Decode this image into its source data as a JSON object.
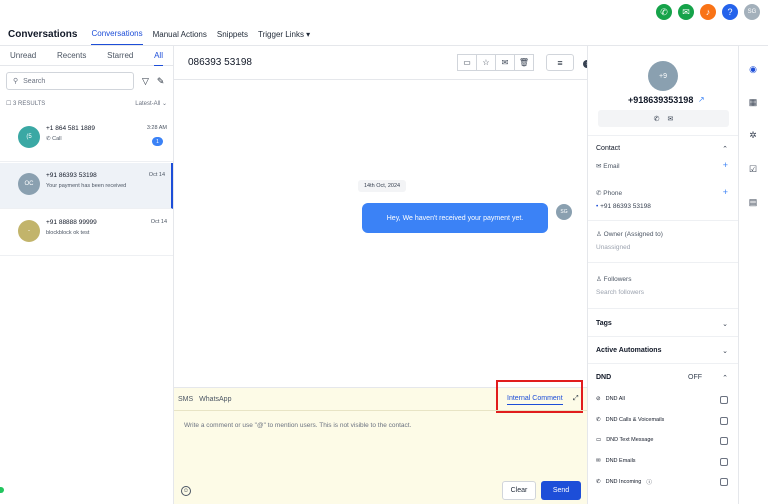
{
  "topbar": {
    "avatar_initials": "SG",
    "help_glyph": "?"
  },
  "nav": {
    "brand": "Conversations",
    "items": [
      "Conversations",
      "Manual Actions",
      "Snippets",
      "Trigger Links ▾"
    ]
  },
  "tabs": [
    "Unread",
    "Recents",
    "Starred",
    "All"
  ],
  "search": {
    "placeholder": "Search"
  },
  "results": {
    "count": "3 RESULTS",
    "filter": "Latest-All"
  },
  "conversations": [
    {
      "initials": "(5",
      "name": "+1 864 581 1889",
      "sub": "Call",
      "time": "3:28 AM",
      "badge": "1",
      "color": "#3aa8a4"
    },
    {
      "initials": "OC",
      "name": "+91 86393 53198",
      "sub": "Your payment has been received",
      "time": "Oct 14",
      "color": "#8aa0b0"
    },
    {
      "initials": "-",
      "name": "+91 88888 99999",
      "sub": "blockblock ok test",
      "time": "Oct 14",
      "color": "#c2b46b"
    }
  ],
  "chat": {
    "title": "086393 53198",
    "date": "14th Oct, 2024",
    "message": "Hey, We haven't received your payment yet.",
    "bubble_avatar": "SG"
  },
  "composer": {
    "tab_sms": "SMS",
    "tab_whatsapp": "WhatsApp",
    "internal_comment": "Internal Comment",
    "placeholder": "Write a comment or use \"@\" to mention users. This is not visible to the contact.",
    "clear": "Clear",
    "send": "Send"
  },
  "contact": {
    "avatar": "+9",
    "phone": "+918639353198",
    "contact_section": "Contact",
    "email_label": "Email",
    "phone_label": "Phone",
    "phone_value": "+91 86393 53198",
    "owner_label": "Owner (Assigned to)",
    "owner_value": "Unassigned",
    "followers_label": "Followers",
    "followers_placeholder": "Search followers",
    "tags": "Tags",
    "automations": "Active Automations",
    "dnd": "DND",
    "dnd_state": "OFF",
    "dnd_items": [
      "DND All",
      "DND Calls & Voicemails",
      "DND Text Message",
      "DND Emails",
      "DND Incoming"
    ]
  },
  "colors": {
    "accent": "#1d4ed8",
    "bubble": "#3b82f6",
    "highlight": "#e11d1d",
    "composer_bg": "#fdfbe7"
  }
}
